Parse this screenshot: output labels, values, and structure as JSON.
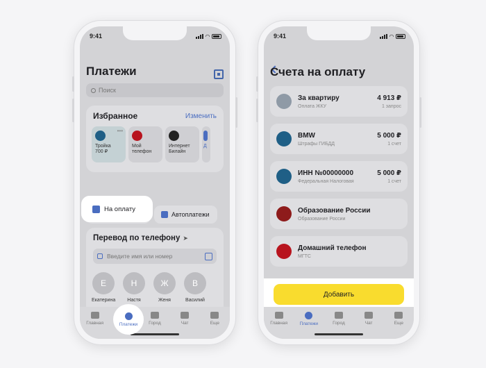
{
  "status_time": "9:41",
  "left": {
    "title": "Платежи",
    "search_placeholder": "Поиск",
    "favorites": {
      "title": "Избранное",
      "edit": "Изменить",
      "tiles": [
        {
          "line1": "Тройка",
          "line2": "700 ₽",
          "color": "#1f5f86"
        },
        {
          "line1": "Мой",
          "line2": "телефон",
          "color": "#b8141e"
        },
        {
          "line1": "Интернет",
          "line2": "Билайн",
          "color": "#222222"
        },
        {
          "line1": "Д",
          "line2": "",
          "color": "#4a6dc0"
        }
      ]
    },
    "pay_pill": "На оплату",
    "autopay_pill": "Автоплатежи",
    "transfer": {
      "title": "Перевод по телефону",
      "input_placeholder": "Введите имя или номер",
      "contacts": [
        {
          "initial": "Е",
          "name": "Екатерина"
        },
        {
          "initial": "Н",
          "name": "Настя"
        },
        {
          "initial": "Ж",
          "name": "Женя"
        },
        {
          "initial": "В",
          "name": "Василий"
        }
      ]
    },
    "tabs": [
      "Главная",
      "Платежи",
      "Город",
      "Чат",
      "Еще"
    ]
  },
  "right": {
    "title": "Счета на оплату",
    "bills": [
      {
        "name": "За квартиру",
        "sub": "Оплата ЖКУ",
        "amount": "4 913 ₽",
        "count": "1 запрос",
        "color": "#8f9aa6"
      },
      {
        "name": "BMW",
        "sub": "Штрафы ГИБДД",
        "amount": "5 000 ₽",
        "count": "1 счет",
        "color": "#1f5f86"
      },
      {
        "name": "ИНН №00000000",
        "sub": "Федеральная Налоговая",
        "amount": "5 000 ₽",
        "count": "1 счет",
        "color": "#1f5f86"
      },
      {
        "name": "Образование России",
        "sub": "Образование России",
        "amount": "",
        "count": "",
        "color": "#8e1b1b"
      },
      {
        "name": "Домашний телефон",
        "sub": "МГТС",
        "amount": "",
        "count": "",
        "color": "#b8141e"
      }
    ],
    "add_button": "Добавить",
    "tabs": [
      "Главная",
      "Платежи",
      "Город",
      "Чат",
      "Еще"
    ]
  },
  "colors": {
    "accent": "#4a6dc0",
    "yellow": "#f9dc2e"
  }
}
